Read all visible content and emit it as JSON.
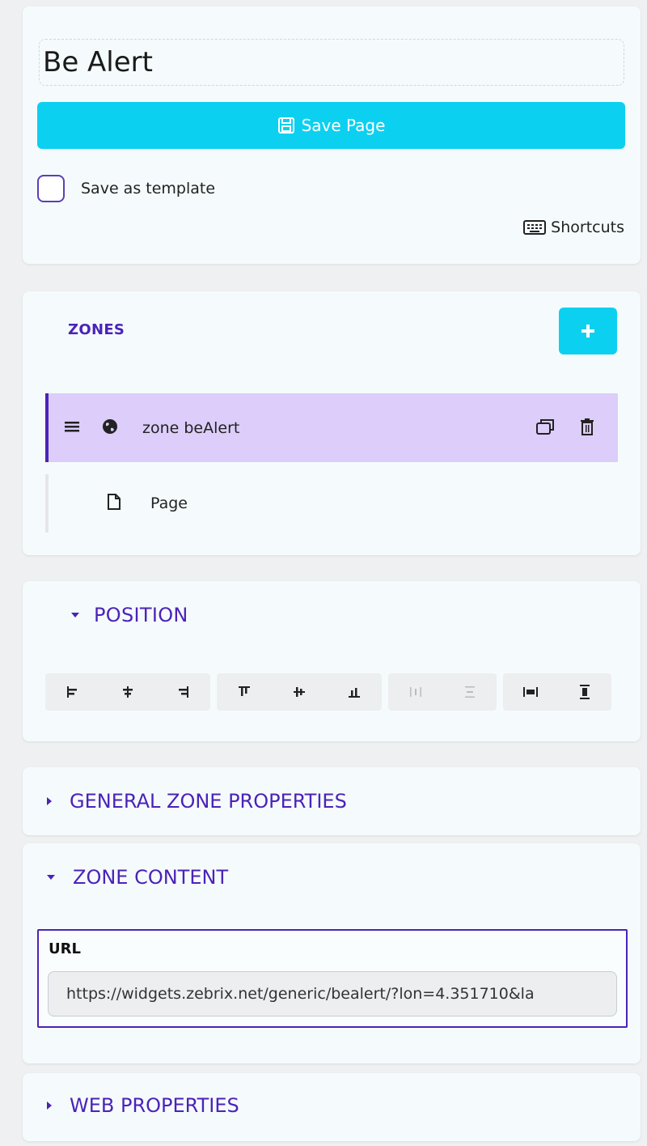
{
  "header": {
    "page_title": "Be Alert",
    "save_label": "Save Page",
    "save_as_template_label": "Save as template",
    "shortcuts_label": "Shortcuts"
  },
  "zones": {
    "title": "ZONES",
    "items": [
      {
        "label": "zone beAlert",
        "selected": true
      },
      {
        "label": "Page",
        "selected": false
      }
    ]
  },
  "position": {
    "title": "POSITION",
    "buttons": [
      "align-left-icon",
      "align-center-horizontal-icon",
      "align-right-icon",
      "align-top-icon",
      "align-middle-vertical-icon",
      "align-bottom-icon",
      "distribute-horizontal-icon",
      "distribute-vertical-icon",
      "stretch-width-icon",
      "stretch-height-icon"
    ]
  },
  "general": {
    "title": "GENERAL ZONE PROPERTIES"
  },
  "content": {
    "title": "ZONE CONTENT",
    "url_label": "URL",
    "url_value": "https://widgets.zebrix.net/generic/bealert/?lon=4.351710&la"
  },
  "web": {
    "title": "WEB PROPERTIES"
  },
  "colors": {
    "accent": "#0cd0f0",
    "purple": "#4b23b8",
    "selected_row": "#dccdfa"
  }
}
